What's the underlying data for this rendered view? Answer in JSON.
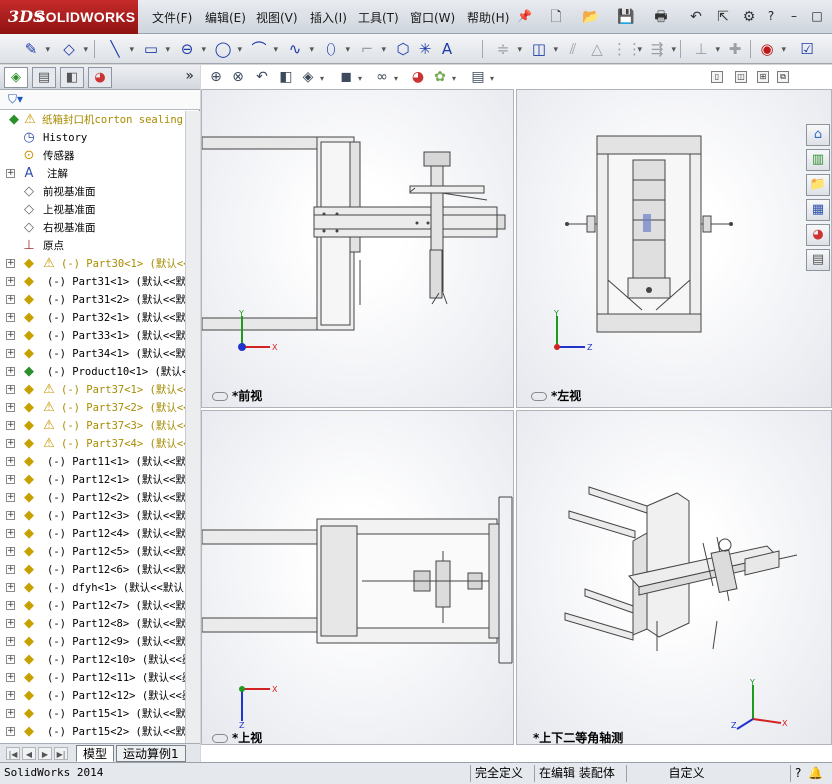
{
  "app": {
    "logo_ds": "3DS",
    "logo_name": "SOLIDWORKS",
    "menus": [
      "文件(F)",
      "编辑(E)",
      "视图(V)",
      "插入(I)",
      "工具(T)",
      "窗口(W)",
      "帮助(H)"
    ],
    "window_controls": [
      "?",
      "–",
      "□",
      "×"
    ]
  },
  "feature_tree": {
    "tabs": [
      "featuremanager",
      "propertymanager",
      "configurationmanager",
      "displaymanager"
    ],
    "more": "»",
    "items": [
      {
        "label": "纸箱封口机corton sealing",
        "icon": "assembly-icon",
        "warn": true,
        "expand": false,
        "indent": 0
      },
      {
        "label": "History",
        "icon": "history-icon",
        "warn": false,
        "expand": false,
        "indent": 1
      },
      {
        "label": "传感器",
        "icon": "sensor-icon",
        "warn": false,
        "expand": false,
        "indent": 1
      },
      {
        "label": "注解",
        "icon": "annotation-icon",
        "warn": false,
        "expand": true,
        "indent": 1
      },
      {
        "label": "前视基准面",
        "icon": "plane-icon",
        "warn": false,
        "expand": false,
        "indent": 1
      },
      {
        "label": "上视基准面",
        "icon": "plane-icon",
        "warn": false,
        "expand": false,
        "indent": 1
      },
      {
        "label": "右视基准面",
        "icon": "plane-icon",
        "warn": false,
        "expand": false,
        "indent": 1
      },
      {
        "label": "原点",
        "icon": "origin-icon",
        "warn": false,
        "expand": false,
        "indent": 1
      },
      {
        "label": "(-) Part30<1> (默认<<",
        "icon": "part-icon",
        "warn": true,
        "expand": true,
        "indent": 1
      },
      {
        "label": "(-) Part31<1> (默认<<默",
        "icon": "part-icon",
        "warn": false,
        "expand": true,
        "indent": 1
      },
      {
        "label": "(-) Part31<2> (默认<<默",
        "icon": "part-icon",
        "warn": false,
        "expand": true,
        "indent": 1
      },
      {
        "label": "(-) Part32<1> (默认<<默",
        "icon": "part-icon",
        "warn": false,
        "expand": true,
        "indent": 1
      },
      {
        "label": "(-) Part33<1> (默认<<默",
        "icon": "part-icon",
        "warn": false,
        "expand": true,
        "indent": 1
      },
      {
        "label": "(-) Part34<1> (默认<<默",
        "icon": "part-icon",
        "warn": false,
        "expand": true,
        "indent": 1
      },
      {
        "label": "(-) Product10<1> (默认<",
        "icon": "subassembly-icon",
        "warn": false,
        "expand": true,
        "indent": 1
      },
      {
        "label": "(-) Part37<1> (默认<<",
        "icon": "part-icon",
        "warn": true,
        "expand": true,
        "indent": 1
      },
      {
        "label": "(-) Part37<2> (默认<<",
        "icon": "part-icon",
        "warn": true,
        "expand": true,
        "indent": 1
      },
      {
        "label": "(-) Part37<3> (默认<<",
        "icon": "part-icon",
        "warn": true,
        "expand": true,
        "indent": 1
      },
      {
        "label": "(-) Part37<4> (默认<<",
        "icon": "part-icon",
        "warn": true,
        "expand": true,
        "indent": 1
      },
      {
        "label": "(-) Part11<1> (默认<<默",
        "icon": "part-icon",
        "warn": false,
        "expand": true,
        "indent": 1
      },
      {
        "label": "(-) Part12<1> (默认<<默",
        "icon": "part-icon",
        "warn": false,
        "expand": true,
        "indent": 1
      },
      {
        "label": "(-) Part12<2> (默认<<默",
        "icon": "part-icon",
        "warn": false,
        "expand": true,
        "indent": 1
      },
      {
        "label": "(-) Part12<3> (默认<<默",
        "icon": "part-icon",
        "warn": false,
        "expand": true,
        "indent": 1
      },
      {
        "label": "(-) Part12<4> (默认<<默",
        "icon": "part-icon",
        "warn": false,
        "expand": true,
        "indent": 1
      },
      {
        "label": "(-) Part12<5> (默认<<默",
        "icon": "part-icon",
        "warn": false,
        "expand": true,
        "indent": 1
      },
      {
        "label": "(-) Part12<6> (默认<<默",
        "icon": "part-icon",
        "warn": false,
        "expand": true,
        "indent": 1
      },
      {
        "label": "(-) dfyh<1> (默认<<默认",
        "icon": "part-icon",
        "warn": false,
        "expand": true,
        "indent": 1
      },
      {
        "label": "(-) Part12<7> (默认<<默",
        "icon": "part-icon",
        "warn": false,
        "expand": true,
        "indent": 1
      },
      {
        "label": "(-) Part12<8> (默认<<默",
        "icon": "part-icon",
        "warn": false,
        "expand": true,
        "indent": 1
      },
      {
        "label": "(-) Part12<9> (默认<<默",
        "icon": "part-icon",
        "warn": false,
        "expand": true,
        "indent": 1
      },
      {
        "label": "(-) Part12<10> (默认<<墨",
        "icon": "part-icon",
        "warn": false,
        "expand": true,
        "indent": 1
      },
      {
        "label": "(-) Part12<11> (默认<<墨",
        "icon": "part-icon",
        "warn": false,
        "expand": true,
        "indent": 1
      },
      {
        "label": "(-) Part12<12> (默认<<墨",
        "icon": "part-icon",
        "warn": false,
        "expand": true,
        "indent": 1
      },
      {
        "label": "(-) Part15<1> (默认<<默",
        "icon": "part-icon",
        "warn": false,
        "expand": true,
        "indent": 1
      },
      {
        "label": "(-) Part15<2> (默认<<默",
        "icon": "part-icon",
        "warn": false,
        "expand": true,
        "indent": 1
      }
    ],
    "bottom_tabs": [
      "模型",
      "运动算例1"
    ]
  },
  "viewports": [
    {
      "name": "front",
      "label": "*前视",
      "triad": [
        "Y",
        "X"
      ]
    },
    {
      "name": "left",
      "label": "*左视",
      "triad": [
        "Y",
        "Z"
      ]
    },
    {
      "name": "top",
      "label": "*上视",
      "triad": [
        "X",
        "Z"
      ]
    },
    {
      "name": "iso",
      "label": "*上下二等角轴测",
      "triad": [
        "Y",
        "X",
        "Z"
      ]
    }
  ],
  "status": {
    "app_name": "SolidWorks 2014",
    "definition": "完全定义",
    "editing": "在编辑 装配体",
    "units": "自定义",
    "help": "?"
  },
  "colors": {
    "accent": "#1d3aa8",
    "warning": "#c99400",
    "logo_red": "#c62b2b",
    "triad_x": "#d22222",
    "triad_y": "#1e9a1e",
    "triad_z": "#2233cc"
  }
}
